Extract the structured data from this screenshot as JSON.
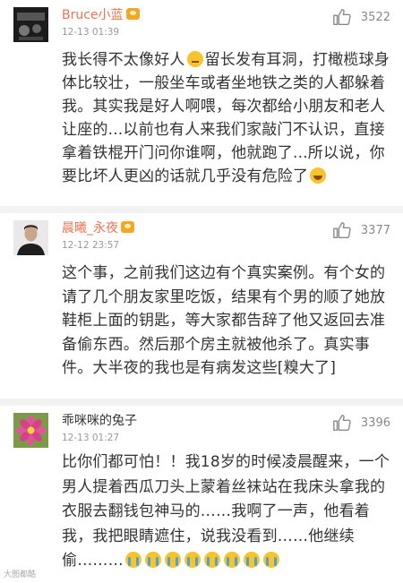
{
  "comments": [
    {
      "username": "Bruce小蓝",
      "badge": "crown-badge-icon",
      "time": "12-13 01:39",
      "likes": "3522",
      "avatar": "dark-photo-avatar",
      "text_parts": [
        "我长得不太像好人",
        "留长发有耳洞，打橄榄球身体比较壮，一般坐车或者坐地铁之类的人都躲着我。其实我是好人啊喂，每次都给小朋友和老人让座的...以前也有人来我们家敲门不认识，直接拿着铁棍开门问你谁啊，他就跑了...所以说，你要比坏人更凶的话就几乎没有危险了"
      ]
    },
    {
      "username": "晨曦_永夜",
      "badge": "crown-badge-icon",
      "time": "12-12 23:57",
      "likes": "3377",
      "avatar": "man-portrait-avatar",
      "text": "这个事，之前我们这边有个真实案例。有个女的请了几个朋友家里吃饭，结果有个男的顺了她放鞋柜上面的钥匙，等大家都告辞了他又返回去准备偷东西。然后那个房主就被他杀了。真实事件。大半夜的我也是有病发这些[糗大了]"
    },
    {
      "username": "乖咪咪的兔子",
      "time": "12-13 01:27",
      "likes": "3396",
      "avatar": "pink-flower-avatar",
      "text": "比你们都可怕！！我18岁的时候凌晨醒来，一个男人提着西瓜刀头上蒙着丝袜站在我床头拿我的衣服去翻钱包神马的……我啊了一声，他看着我，我把眼睛遮住，说我没看到……他继续偷………"
    }
  ],
  "watermark": "大图都酷",
  "colors": {
    "username": "#eb7350",
    "time": "#999999",
    "text": "#333333",
    "background": "#f2f2f2"
  }
}
